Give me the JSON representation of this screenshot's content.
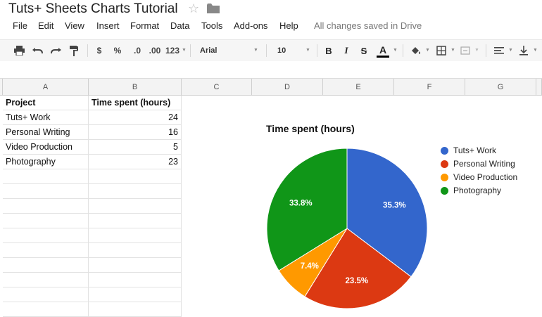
{
  "doc": {
    "title": "Tuts+ Sheets Charts Tutorial"
  },
  "menu": {
    "items": [
      "File",
      "Edit",
      "View",
      "Insert",
      "Format",
      "Data",
      "Tools",
      "Add-ons",
      "Help"
    ],
    "saved_status": "All changes saved in Drive"
  },
  "toolbar": {
    "currency": "$",
    "percent": "%",
    "decrease_decimal": ".0",
    "increase_decimal": ".00",
    "more_formats": "123",
    "font": "Arial",
    "font_size": "10",
    "bold": "B",
    "italic": "I",
    "strikethrough": "S",
    "text_color": "A"
  },
  "sheet": {
    "columns": [
      "A",
      "B",
      "C",
      "D",
      "E",
      "F",
      "G"
    ],
    "rows": [
      [
        "Project",
        "Time spent (hours)"
      ],
      [
        "Tuts+ Work",
        "24"
      ],
      [
        "Personal Writing",
        "16"
      ],
      [
        "Video Production",
        "5"
      ],
      [
        "Photography",
        "23"
      ]
    ]
  },
  "chart_data": {
    "type": "pie",
    "title": "Time spent (hours)",
    "categories": [
      "Tuts+ Work",
      "Personal Writing",
      "Video Production",
      "Photography"
    ],
    "values": [
      24,
      16,
      5,
      23
    ],
    "labels": [
      "35.3%",
      "23.5%",
      "7.4%",
      "33.8%"
    ],
    "colors": [
      "#3366cc",
      "#dc3912",
      "#ff9900",
      "#109618"
    ],
    "legend": "right"
  }
}
